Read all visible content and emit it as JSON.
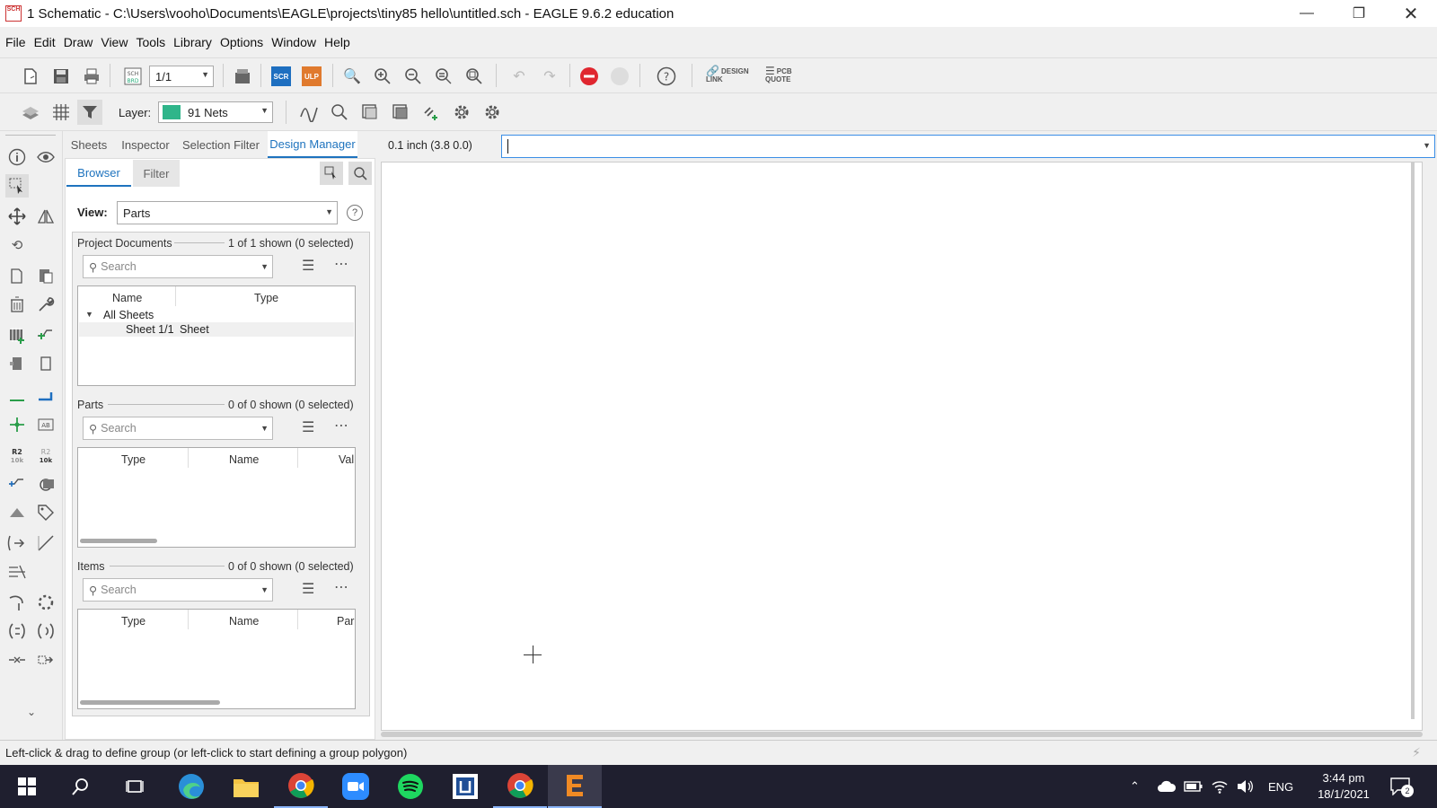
{
  "window": {
    "title": "1 Schematic - C:\\Users\\vooho\\Documents\\EAGLE\\projects\\tiny85 hello\\untitled.sch - EAGLE 9.6.2 education",
    "app_icon_text": "SCH"
  },
  "menu": [
    "File",
    "Edit",
    "Draw",
    "View",
    "Tools",
    "Library",
    "Options",
    "Window",
    "Help"
  ],
  "toolbar": {
    "sheet_select": "1/1",
    "scr_label": "SCR",
    "ulp_label": "ULP",
    "design_link_label": "DESIGN LINK",
    "pcb_quote_label": "PCB QUOTE",
    "layer_label": "Layer:",
    "layer_value": "91 Nets",
    "layer_color": "#2fb58a"
  },
  "panel": {
    "tabs": [
      "Sheets",
      "Inspector",
      "Selection Filter",
      "Design Manager"
    ],
    "active_tab": "Design Manager",
    "subtabs": [
      "Browser",
      "Filter"
    ],
    "view_label": "View:",
    "view_value": "Parts",
    "project_documents": {
      "title": "Project Documents",
      "count": "1 of 1 shown (0 selected)",
      "search_placeholder": "Search",
      "columns": [
        "Name",
        "Type"
      ],
      "group": "All Sheets",
      "rows": [
        {
          "name": "Sheet 1/1",
          "type": "Sheet"
        }
      ]
    },
    "parts": {
      "title": "Parts",
      "count": "0 of 0 shown (0 selected)",
      "search_placeholder": "Search",
      "columns": [
        "Type",
        "Name",
        "Val"
      ]
    },
    "items": {
      "title": "Items",
      "count": "0 of 0 shown (0 selected)",
      "search_placeholder": "Search",
      "columns": [
        "Type",
        "Name",
        "Pare"
      ]
    }
  },
  "grid_info": "0.1 inch (3.8 0.0)",
  "command_value": "",
  "status": "Left-click & drag to define group (or left-click to start defining a group polygon)",
  "taskbar": {
    "lang": "ENG",
    "time": "3:44 pm",
    "date": "18/1/2021",
    "notifications": "2"
  }
}
